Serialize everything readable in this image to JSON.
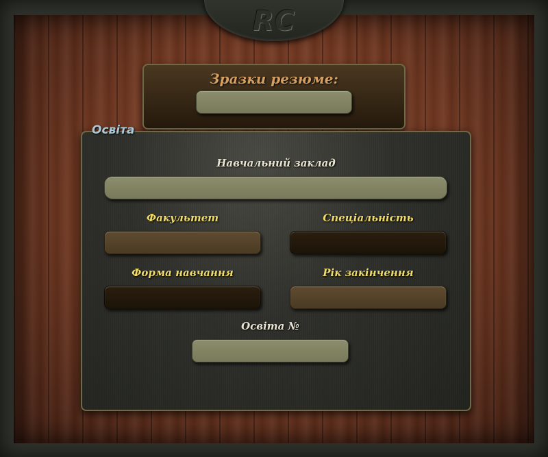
{
  "logo": {
    "text": "RC"
  },
  "samples": {
    "title": "Зразки резюме:",
    "value": ""
  },
  "education": {
    "legend": "Освіта",
    "institution": {
      "label": "Навчальний заклад",
      "value": ""
    },
    "faculty": {
      "label": "Факультет",
      "value": ""
    },
    "specialty": {
      "label": "Спеціальність",
      "value": ""
    },
    "study_form": {
      "label": "Форма навчання",
      "value": ""
    },
    "graduation_year": {
      "label": "Рік закінчення",
      "value": ""
    },
    "education_number": {
      "label": "Освіта №",
      "value": ""
    }
  },
  "colors": {
    "olive_field": "#818362",
    "brown_field": "#564429",
    "dark_field": "#231909",
    "label_yellow": "#f0dc6a",
    "samples_title": "#d69f62",
    "legend_blue": "#a9c8d8"
  }
}
